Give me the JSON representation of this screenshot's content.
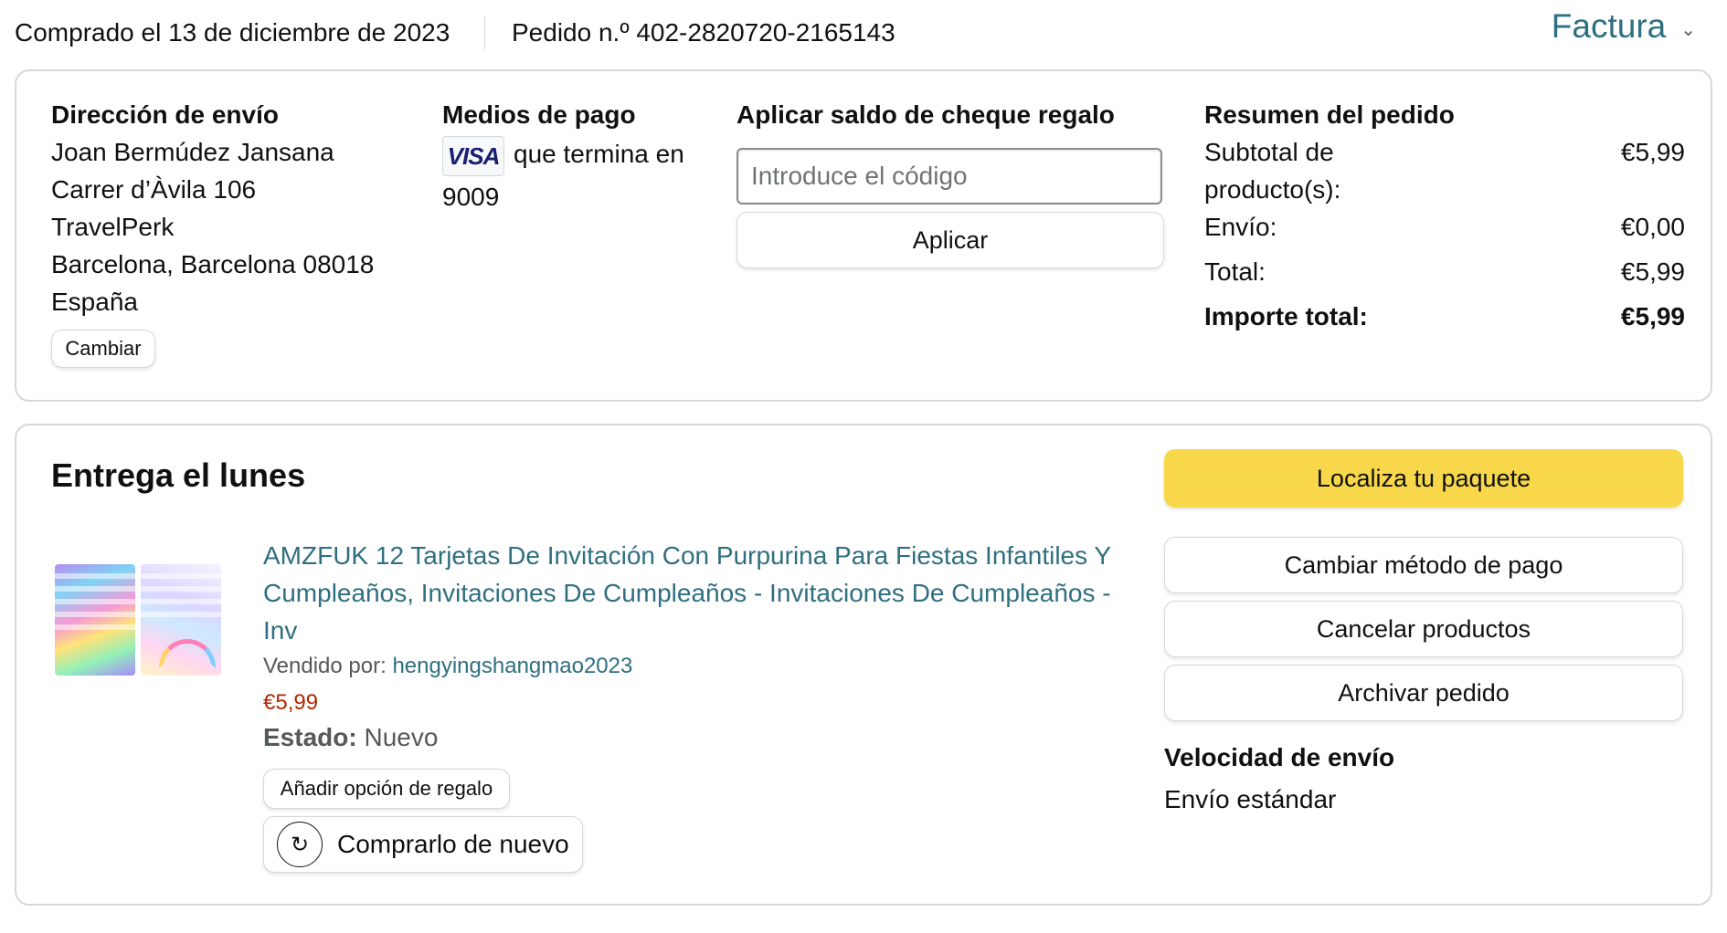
{
  "header": {
    "purchased_date": "Comprado el 13 de diciembre de 2023",
    "order_number": "Pedido n.º 402-2820720-2165143",
    "invoice_label": "Factura",
    "invoice_icon": "chevron-down-icon"
  },
  "shipping": {
    "heading": "Dirección de envío",
    "name": "Joan Bermúdez Jansana",
    "line1": "Carrer d’Àvila 106",
    "line2": "TravelPerk",
    "city": "Barcelona, Barcelona 08018",
    "country": "España",
    "change_button": "Cambiar"
  },
  "payment": {
    "heading": "Medios de pago",
    "card_brand": "VISA",
    "ending_text": "que termina en",
    "last_digits": "9009"
  },
  "gift_card": {
    "heading": "Aplicar saldo de cheque regalo",
    "placeholder": "Introduce el código",
    "value": "",
    "apply_button": "Aplicar"
  },
  "summary": {
    "heading": "Resumen del pedido",
    "subtotal_label": "Subtotal de producto(s):",
    "subtotal_value": "€5,99",
    "shipping_label": "Envío:",
    "shipping_value": "€0,00",
    "total_label": "Total:",
    "total_value": "€5,99",
    "grand_total_label": "Importe total:",
    "grand_total_value": "€5,99"
  },
  "delivery": {
    "title": "Entrega el lunes",
    "product": {
      "title": "AMZFUK 12 Tarjetas De Invitación Con Purpurina Para Fiestas Infantiles Y Cumpleaños, Invitaciones De Cumpleaños - Invitaciones De Cumpleaños - Inv",
      "sold_by_label": "Vendido por:",
      "seller": "hengyingshangmao2023",
      "price": "€5,99",
      "condition_label": "Estado:",
      "condition_value": "Nuevo",
      "gift_option_button": "Añadir opción de regalo",
      "buy_again_button": "Comprarlo de nuevo"
    },
    "actions": {
      "track": "Localiza tu paquete",
      "change_payment": "Cambiar método de pago",
      "cancel": "Cancelar productos",
      "archive": "Archivar pedido"
    },
    "speed_heading": "Velocidad de envío",
    "speed_value": "Envío estándar"
  },
  "colors": {
    "link": "#2f6f80",
    "price": "#b12704",
    "primary_button": "#f8d84a",
    "border": "#d5d9d9"
  }
}
